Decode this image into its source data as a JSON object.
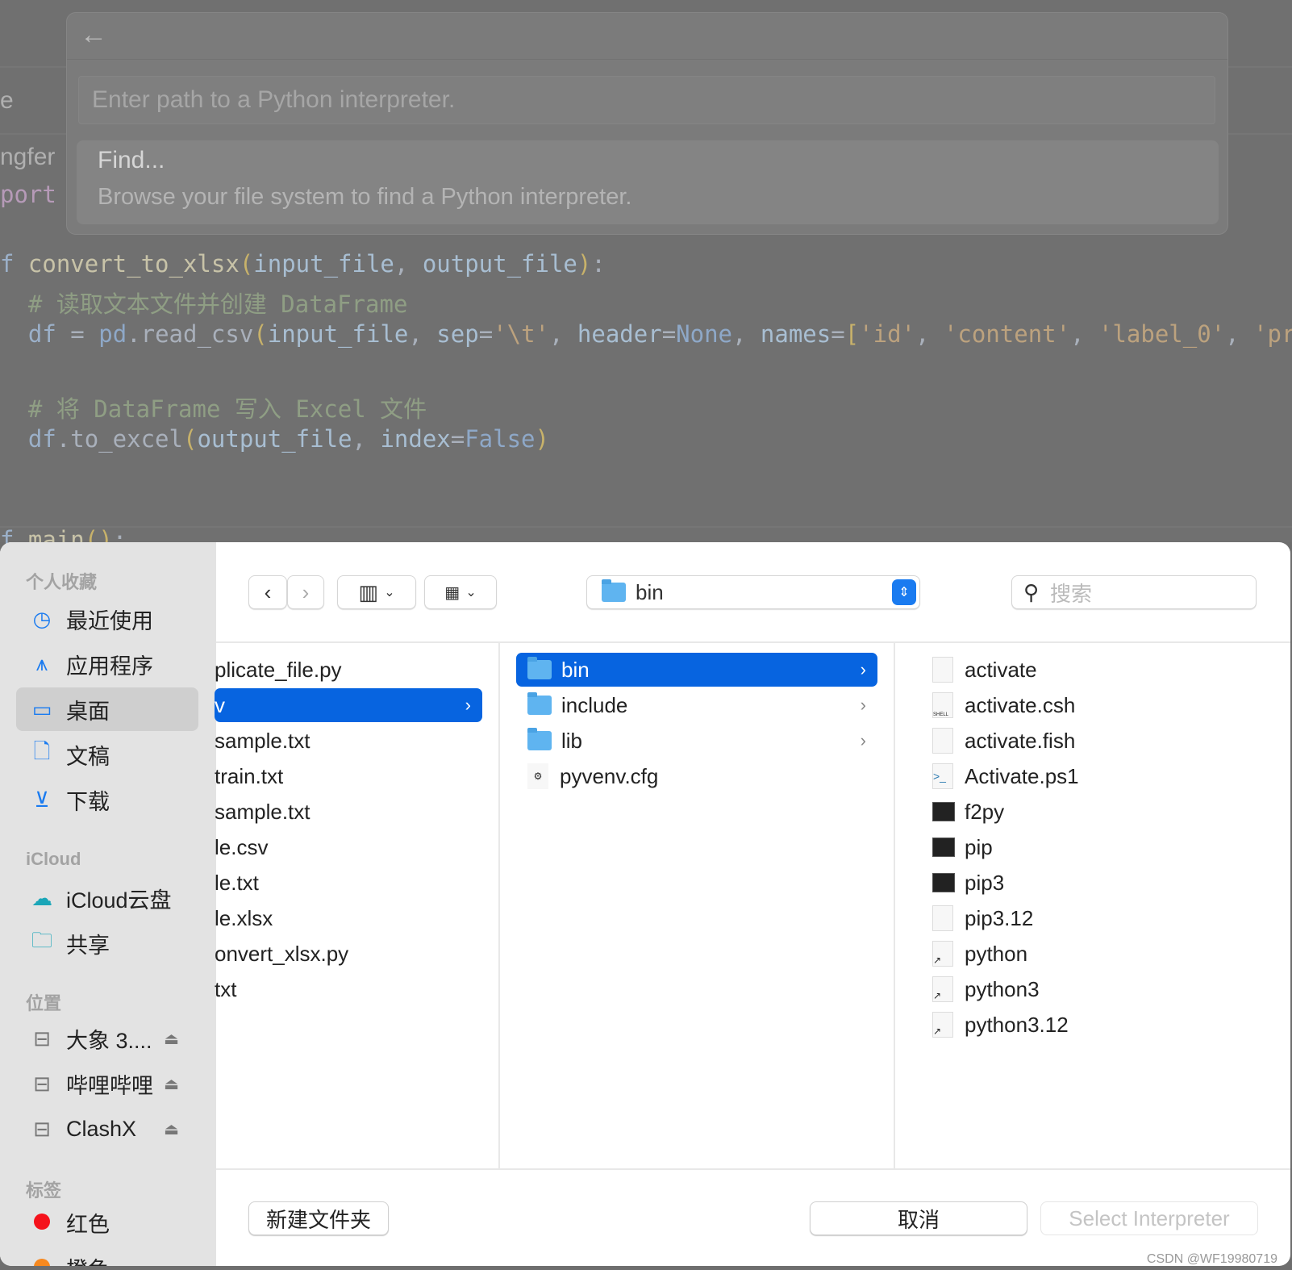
{
  "editor": {
    "side_fragments": [
      "e",
      "ngfer",
      "port"
    ],
    "code_lines": [
      {
        "parts": [
          [
            "kw",
            "f "
          ],
          [
            "fn",
            "convert_to_xlsx"
          ],
          [
            "br",
            "("
          ],
          [
            "par",
            "input_file"
          ],
          [
            "",
            ","
          ],
          [
            "par",
            " output_file"
          ],
          [
            "br",
            ")"
          ],
          [
            "",
            ":"
          ]
        ]
      },
      {
        "parts": [
          [
            "cm",
            "  # 读取文本文件并创建 DataFrame"
          ]
        ]
      },
      {
        "parts": [
          [
            "kw",
            "  df"
          ],
          [
            "",
            " = "
          ],
          [
            "cst",
            "pd"
          ],
          [
            "",
            ".read_csv"
          ],
          [
            "br",
            "("
          ],
          [
            "par",
            "input_file"
          ],
          [
            "",
            ", "
          ],
          [
            "par",
            "sep"
          ],
          [
            "",
            "="
          ],
          [
            "str",
            "'\\t'"
          ],
          [
            "",
            ", "
          ],
          [
            "par",
            "header"
          ],
          [
            "",
            "="
          ],
          [
            "cst",
            "None"
          ],
          [
            "",
            ", "
          ],
          [
            "par",
            "names"
          ],
          [
            "",
            "="
          ],
          [
            "br",
            "["
          ],
          [
            "str",
            "'id'"
          ],
          [
            "",
            ", "
          ],
          [
            "str",
            "'content'"
          ],
          [
            "",
            ", "
          ],
          [
            "str",
            "'label_0'"
          ],
          [
            "",
            ", "
          ],
          [
            "str",
            "'pre"
          ]
        ]
      },
      {
        "parts": [
          [
            "cm",
            "  # 将 DataFrame 写入 Excel 文件"
          ]
        ]
      },
      {
        "parts": [
          [
            "kw",
            "  df"
          ],
          [
            "",
            ".to_excel"
          ],
          [
            "br",
            "("
          ],
          [
            "par",
            "output_file"
          ],
          [
            "",
            ", "
          ],
          [
            "par",
            "index"
          ],
          [
            "",
            "="
          ],
          [
            "cst",
            "False"
          ],
          [
            "br",
            ")"
          ]
        ]
      },
      {
        "parts": [
          [
            "kw",
            "f "
          ],
          [
            "fn",
            "main"
          ],
          [
            "br",
            "()"
          ],
          [
            "",
            ":"
          ]
        ]
      }
    ]
  },
  "palette": {
    "back_icon": "arrow-left",
    "input_placeholder": "Enter path to a Python interpreter.",
    "item_title": "Find...",
    "item_description": "Browse your file system to find a Python interpreter."
  },
  "sidebar": {
    "favorites_header": "个人收藏",
    "favorites": [
      {
        "icon": "clock",
        "label": "最近使用"
      },
      {
        "icon": "app-store",
        "label": "应用程序"
      },
      {
        "icon": "desktop",
        "label": "桌面",
        "selected": true
      },
      {
        "icon": "document",
        "label": "文稿"
      },
      {
        "icon": "download",
        "label": "下载"
      }
    ],
    "icloud_header": "iCloud",
    "icloud": [
      {
        "icon": "cloud",
        "label": "iCloud云盘"
      },
      {
        "icon": "shared-folder",
        "label": "共享"
      }
    ],
    "locations_header": "位置",
    "locations": [
      {
        "icon": "drive",
        "label": "大象 3...."
      },
      {
        "icon": "drive",
        "label": "哔哩哔哩"
      },
      {
        "icon": "drive",
        "label": "ClashX"
      }
    ],
    "tags_header": "标签",
    "tags": [
      {
        "label": "红色",
        "color": "#f5121b"
      },
      {
        "label": "橙色",
        "color": "#f7891f"
      }
    ]
  },
  "toolbar": {
    "location": "bin",
    "search_placeholder": "搜索"
  },
  "columns": {
    "col1": [
      {
        "name": "plicate_file.py"
      },
      {
        "name": "v",
        "selected": true,
        "folder": true
      },
      {
        "name": "sample.txt"
      },
      {
        "name": "train.txt"
      },
      {
        "name": "sample.txt"
      },
      {
        "name": "le.csv"
      },
      {
        "name": "le.txt"
      },
      {
        "name": "le.xlsx"
      },
      {
        "name": "onvert_xlsx.py"
      },
      {
        "name": "txt"
      }
    ],
    "col2": [
      {
        "name": "bin",
        "type": "folder",
        "selected": true
      },
      {
        "name": "include",
        "type": "folder"
      },
      {
        "name": "lib",
        "type": "folder"
      },
      {
        "name": "pyvenv.cfg",
        "type": "config"
      }
    ],
    "col3": [
      {
        "name": "activate",
        "type": "file"
      },
      {
        "name": "activate.csh",
        "type": "shell"
      },
      {
        "name": "activate.fish",
        "type": "file"
      },
      {
        "name": "Activate.ps1",
        "type": "powershell"
      },
      {
        "name": "f2py",
        "type": "exec"
      },
      {
        "name": "pip",
        "type": "exec"
      },
      {
        "name": "pip3",
        "type": "exec"
      },
      {
        "name": "pip3.12",
        "type": "file"
      },
      {
        "name": "python",
        "type": "alias"
      },
      {
        "name": "python3",
        "type": "alias"
      },
      {
        "name": "python3.12",
        "type": "alias"
      }
    ]
  },
  "footer": {
    "new_folder": "新建文件夹",
    "cancel": "取消",
    "select": "Select Interpreter"
  },
  "watermark": "CSDN @WF19980719",
  "colors": {
    "accent": "#0764e0"
  }
}
